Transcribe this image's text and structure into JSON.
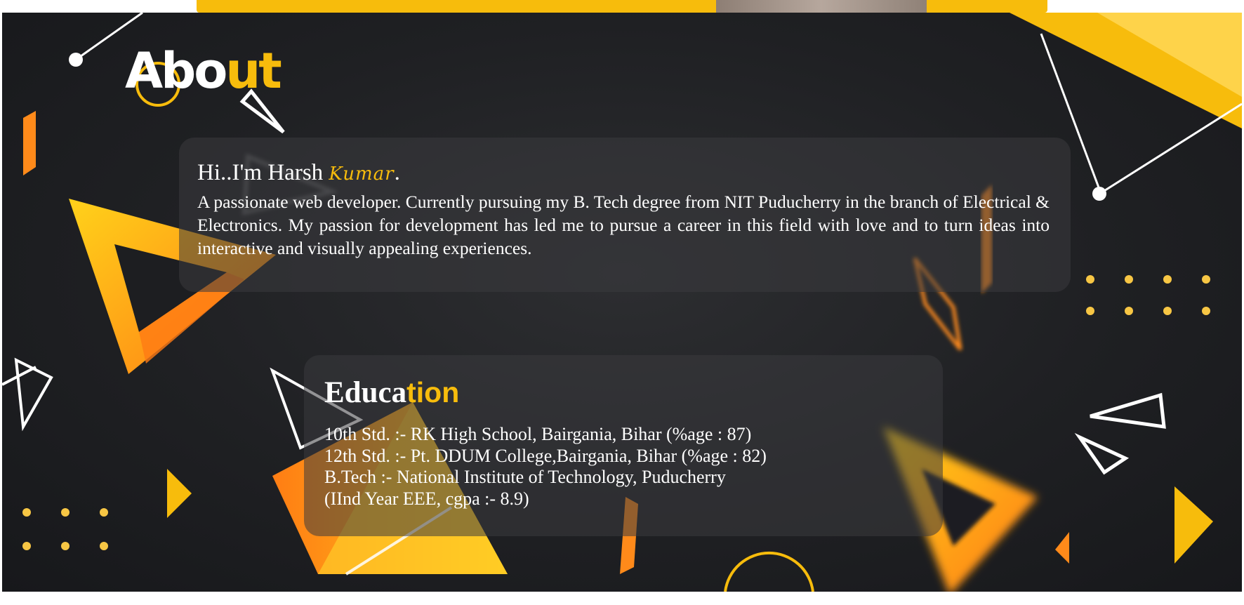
{
  "about": {
    "heading_white": "Abo",
    "heading_gold": "ut"
  },
  "intro": {
    "greeting": "Hi..I'm Harsh ",
    "surname": "Kumar",
    "period": ".",
    "description": "A passionate web developer. Currently pursuing my B. Tech degree from NIT Puducherry in the branch of Electrical & Electronics. My passion for development has led me to pursue a career in this field with love and to turn ideas into interactive and visually appealing experiences."
  },
  "education": {
    "heading_white": "Educa",
    "heading_gold": "tion",
    "items": [
      "10th Std. :- RK High School, Bairgania, Bihar (%age : 87)",
      "12th Std. :- Pt. DDUM College,Bairgania, Bihar (%age : 82)",
      "B.Tech :- National Institute of Technology, Puducherry",
      "(IInd Year EEE, cgpa :- 8.9)"
    ]
  },
  "colors": {
    "accent_gold": "#f7bc0c",
    "accent_orange": "#ff8a1a",
    "background_dark": "#1f2023",
    "text": "#ffffff"
  }
}
